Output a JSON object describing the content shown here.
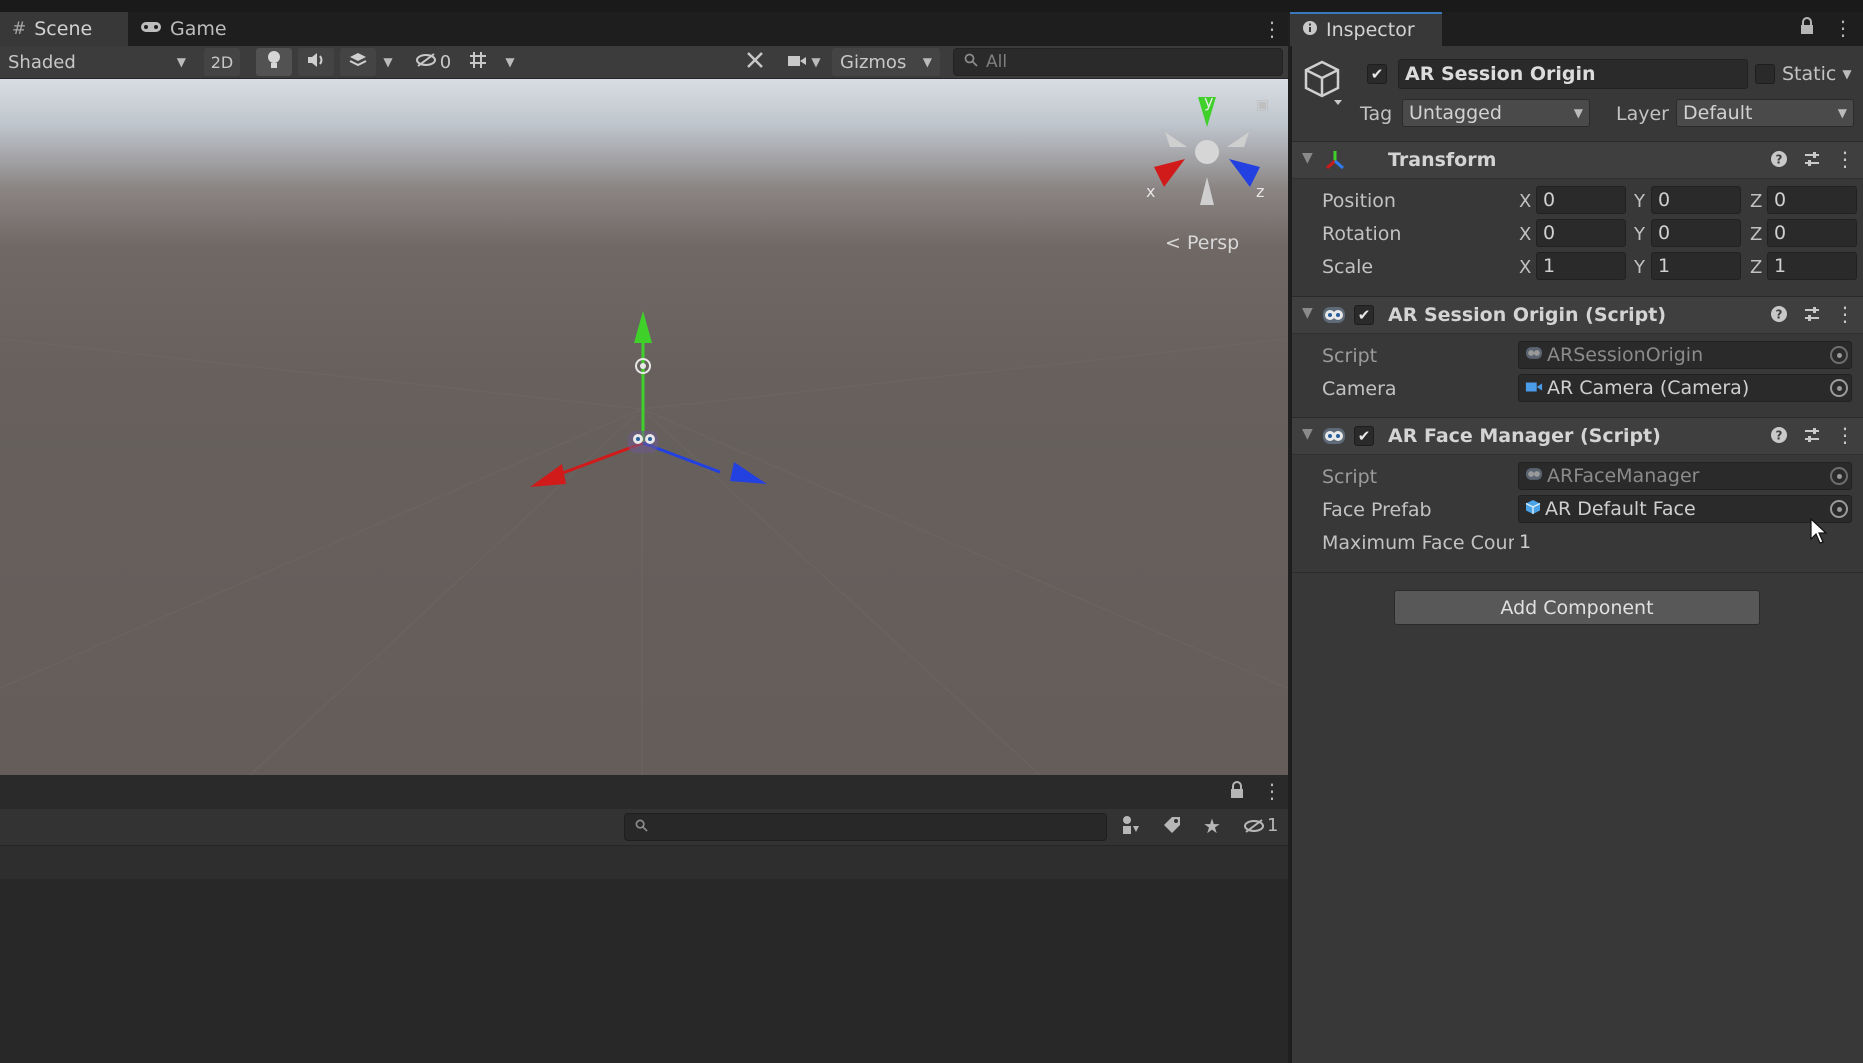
{
  "scene_tabs": {
    "scene": "Scene",
    "game": "Game"
  },
  "scene_toolbar": {
    "draw_mode": "Shaded",
    "mode_2d": "2D",
    "hidden_count": "0",
    "gizmos": "Gizmos",
    "search_placeholder": "All"
  },
  "viewport": {
    "orientation_labels": {
      "x": "x",
      "y": "y",
      "z": "z"
    },
    "persp_label": "Persp",
    "colors": {
      "sky": "#c5ccd3",
      "ground": "#645d5a",
      "x_axis": "#d11a1a",
      "y_axis": "#3fd12a",
      "z_axis": "#2340e0"
    }
  },
  "bottom_panel": {
    "hidden_count": "1"
  },
  "inspector": {
    "tab": "Inspector",
    "object": {
      "name": "AR Session Origin",
      "active": true,
      "static_label": "Static",
      "tag_label": "Tag",
      "tag": "Untagged",
      "layer_label": "Layer",
      "layer": "Default"
    },
    "transform": {
      "title": "Transform",
      "rows": [
        {
          "label": "Position",
          "x": "0",
          "y": "0",
          "z": "0"
        },
        {
          "label": "Rotation",
          "x": "0",
          "y": "0",
          "z": "0"
        },
        {
          "label": "Scale",
          "x": "1",
          "y": "1",
          "z": "1"
        }
      ],
      "axis_labels": {
        "x": "X",
        "y": "Y",
        "z": "Z"
      }
    },
    "session_origin": {
      "title": "AR Session Origin (Script)",
      "script_label": "Script",
      "script_value": "ARSessionOrigin",
      "camera_label": "Camera",
      "camera_value": "AR Camera (Camera)"
    },
    "face_manager": {
      "title": "AR Face Manager (Script)",
      "script_label": "Script",
      "script_value": "ARFaceManager",
      "prefab_label": "Face Prefab",
      "prefab_value": "AR Default Face",
      "max_label": "Maximum Face Coun",
      "max_value": "1"
    },
    "add_component": "Add Component"
  }
}
